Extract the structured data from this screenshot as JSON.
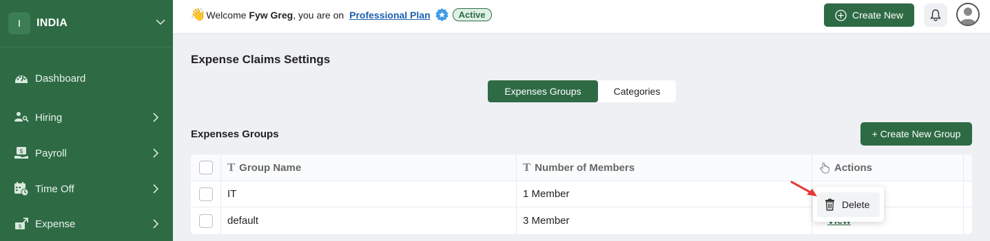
{
  "sidebar": {
    "org_initial": "I",
    "org_name": "INDIA",
    "items": [
      {
        "label": "Dashboard",
        "icon": "dashboard-gauge-icon",
        "has_children": false
      },
      {
        "label": "Hiring",
        "icon": "hiring-people-icon",
        "has_children": true
      },
      {
        "label": "Payroll",
        "icon": "payroll-money-icon",
        "has_children": true
      },
      {
        "label": "Time Off",
        "icon": "calendar-clock-icon",
        "has_children": true
      },
      {
        "label": "Expense",
        "icon": "expense-money-icon",
        "has_children": true
      }
    ]
  },
  "topbar": {
    "wave_emoji": "👋",
    "welcome_prefix": "Welcome",
    "user_name": "Fyw Greg",
    "welcome_suffix": ", you are on",
    "plan_name": "Professional Plan",
    "plan_status": "Active",
    "create_new_label": "Create New"
  },
  "main": {
    "page_title": "Expense Claims Settings",
    "tabs": [
      {
        "label": "Expenses Groups",
        "active": true
      },
      {
        "label": "Categories",
        "active": false
      }
    ],
    "section_title": "Expenses Groups",
    "create_group_label": "+ Create New Group",
    "table": {
      "columns": [
        "Group Name",
        "Number of Members",
        "Actions"
      ],
      "rows": [
        {
          "group_name": "IT",
          "members": "1 Member",
          "action": ""
        },
        {
          "group_name": "default",
          "members": "3 Member",
          "action": "View"
        }
      ]
    },
    "context_menu": {
      "items": [
        {
          "label": "Delete",
          "icon": "trash-icon"
        }
      ]
    }
  },
  "colors": {
    "brand_green": "#2e6b45",
    "link_blue": "#1a5fb4",
    "annotation_arrow": "#e53935",
    "page_bg": "#eef0f4"
  }
}
